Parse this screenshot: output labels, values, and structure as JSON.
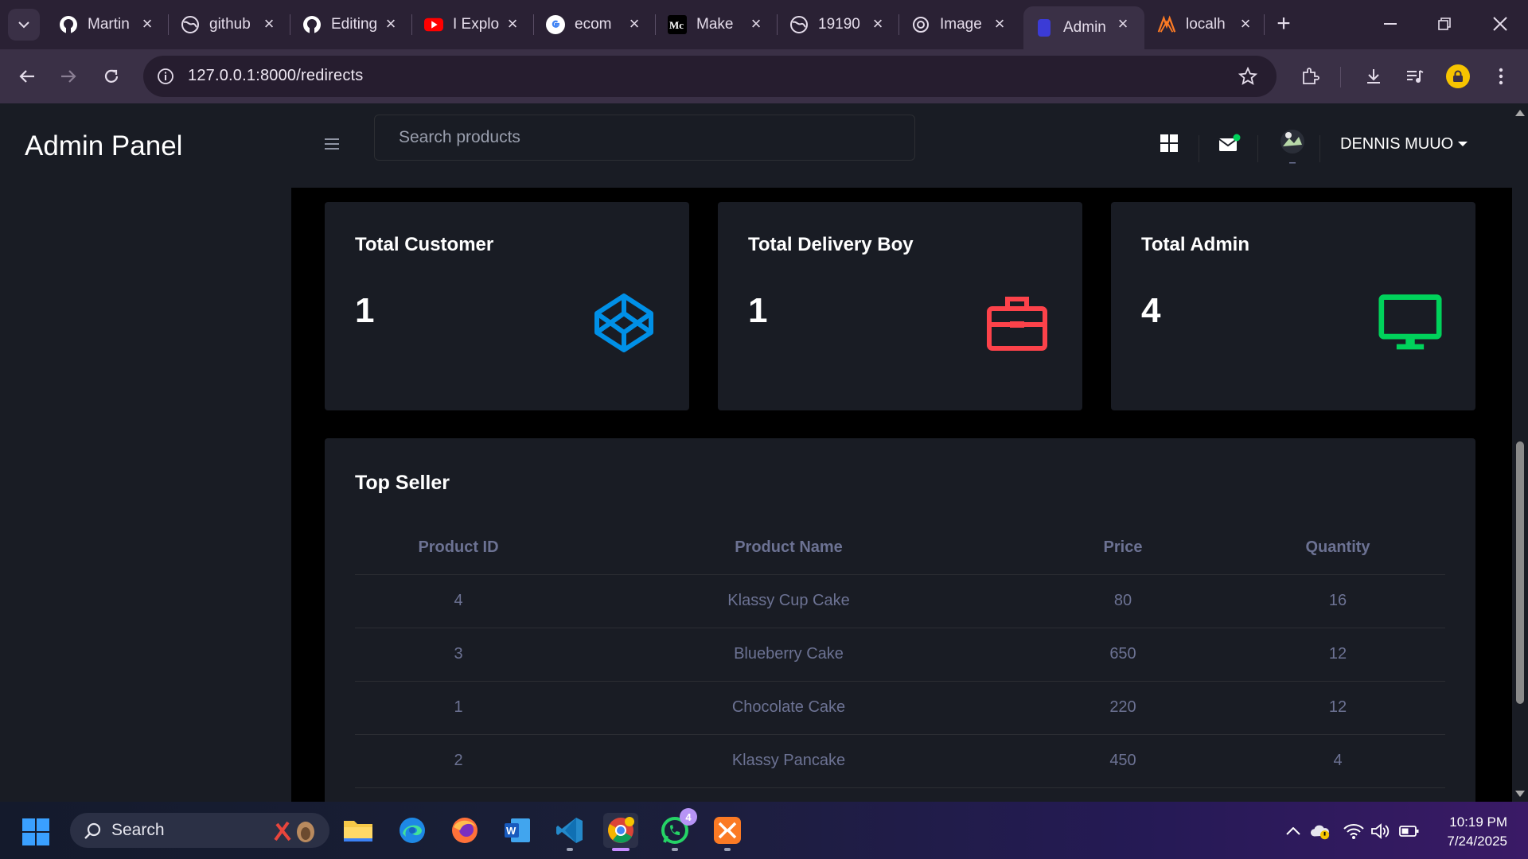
{
  "browser": {
    "tabs": [
      {
        "label": "Martin",
        "favicon": "github-icon"
      },
      {
        "label": "github",
        "favicon": "globe-icon"
      },
      {
        "label": "Editing",
        "favicon": "github-icon"
      },
      {
        "label": "I Explo",
        "favicon": "youtube-icon"
      },
      {
        "label": "ecom",
        "favicon": "google-icon"
      },
      {
        "label": "Make",
        "favicon": "medium-icon"
      },
      {
        "label": "19190",
        "favicon": "globe-icon"
      },
      {
        "label": "Image",
        "favicon": "openai-icon"
      },
      {
        "label": "Admin",
        "favicon": "bootstrap-icon",
        "active": true
      },
      {
        "label": "localh",
        "favicon": "xampp-icon"
      }
    ],
    "url": "127.0.0.1:8000/redirects"
  },
  "app": {
    "brand": "Admin Panel",
    "search_placeholder": "Search products",
    "user_name": "DENNIS MUUO"
  },
  "stats": [
    {
      "title": "Total Customer",
      "value": "1",
      "icon": "codepen-icon",
      "color": "#0090e7"
    },
    {
      "title": "Total Delivery Boy",
      "value": "1",
      "icon": "briefcase-icon",
      "color": "#fc424a"
    },
    {
      "title": "Total Admin",
      "value": "4",
      "icon": "monitor-icon",
      "color": "#00d25b"
    }
  ],
  "top_seller": {
    "title": "Top Seller",
    "columns": [
      "Product ID",
      "Product Name",
      "Price",
      "Quantity"
    ],
    "rows": [
      [
        "4",
        "Klassy Cup Cake",
        "80",
        "16"
      ],
      [
        "3",
        "Blueberry Cake",
        "650",
        "12"
      ],
      [
        "1",
        "Chocolate Cake",
        "220",
        "12"
      ],
      [
        "2",
        "Klassy Pancake",
        "450",
        "4"
      ]
    ]
  },
  "taskbar": {
    "search_label": "Search",
    "whatsapp_badge": "4",
    "time": "10:19 PM",
    "date": "7/24/2025"
  }
}
